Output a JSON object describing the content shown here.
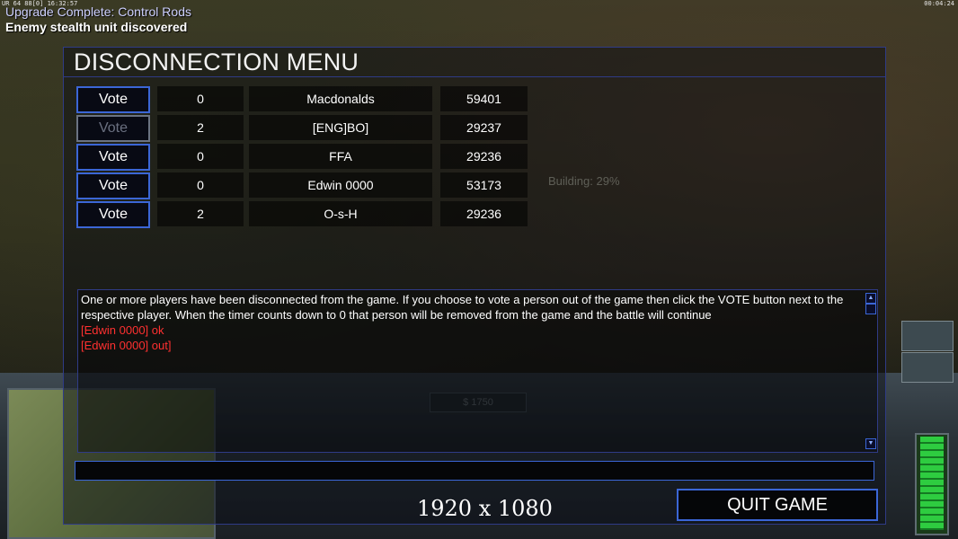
{
  "overlay": {
    "top_left_stats": "UR 64 88[0] 16:32:57",
    "top_right_time": "00:04:24",
    "notices": [
      "Upgrade Complete: Control Rods",
      "Enemy stealth unit discovered"
    ],
    "building_progress": "Building: 29%",
    "hud_cash": "$ 1750",
    "power_level_fraction": 0.95
  },
  "dialog": {
    "title": "DISCONNECTION MENU",
    "vote_label": "Vote",
    "players": [
      {
        "votes": "0",
        "name": "Macdonalds",
        "ping": "59401",
        "vote_enabled": true
      },
      {
        "votes": "2",
        "name": "[ENG]BO]",
        "ping": "29237",
        "vote_enabled": false
      },
      {
        "votes": "0",
        "name": "FFA",
        "ping": "29236",
        "vote_enabled": true
      },
      {
        "votes": "0",
        "name": "Edwin 0000",
        "ping": "53173",
        "vote_enabled": true
      },
      {
        "votes": "2",
        "name": "O-s-H",
        "ping": "29236",
        "vote_enabled": true
      }
    ],
    "messages": {
      "info": "One or more players have been disconnected from the game. If you choose to vote a person out of the game then click the VOTE button next to the respective player. When the timer counts down to 0 that person will be removed from the game and the battle will continue",
      "status_lines": [
        "[Edwin 0000] ok",
        "[Edwin 0000] out]"
      ]
    },
    "chat_input_value": "",
    "resolution_label": "1920 x 1080",
    "quit_label": "QUIT GAME"
  },
  "colors": {
    "accent": "#3b66d6",
    "alert": "#ff3030",
    "notice": "#cdd0ff"
  }
}
